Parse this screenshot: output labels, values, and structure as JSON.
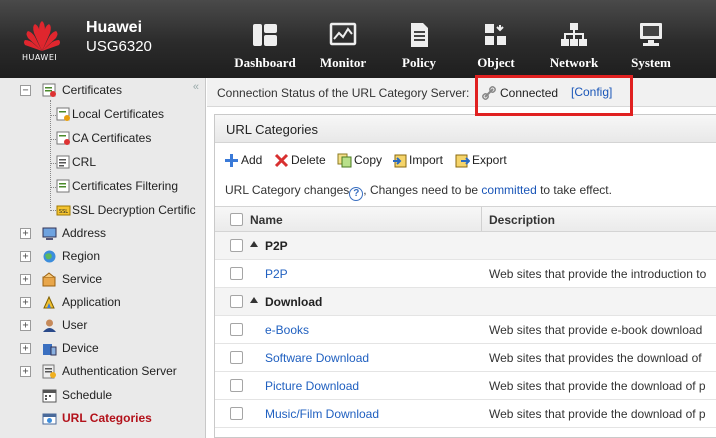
{
  "header": {
    "brand": "HUAWEI",
    "vendor": "Huawei",
    "model": "USG6320",
    "nav": [
      {
        "id": "dashboard",
        "label": "Dashboard"
      },
      {
        "id": "monitor",
        "label": "Monitor"
      },
      {
        "id": "policy",
        "label": "Policy"
      },
      {
        "id": "object",
        "label": "Object",
        "active": true
      },
      {
        "id": "network",
        "label": "Network"
      },
      {
        "id": "system",
        "label": "System"
      }
    ]
  },
  "sidebar": {
    "collapse_icon": "«",
    "items": [
      {
        "label": "Certificates",
        "expander": "−"
      },
      {
        "label": "Local Certificates"
      },
      {
        "label": "CA Certificates"
      },
      {
        "label": "CRL"
      },
      {
        "label": "Certificates Filtering"
      },
      {
        "label": "SSL Decryption Certific"
      },
      {
        "label": "Address",
        "expander": "+"
      },
      {
        "label": "Region",
        "expander": "+"
      },
      {
        "label": "Service",
        "expander": "+"
      },
      {
        "label": "Application",
        "expander": "+"
      },
      {
        "label": "User",
        "expander": "+"
      },
      {
        "label": "Device",
        "expander": "+"
      },
      {
        "label": "Authentication Server",
        "expander": "+"
      },
      {
        "label": "Schedule"
      },
      {
        "label": "URL Categories",
        "selected": true
      }
    ]
  },
  "status": {
    "label": "Connection Status of the URL Category Server:",
    "value": "Connected",
    "config_link": "[Config]"
  },
  "panel": {
    "title": "URL Categories",
    "toolbar": {
      "add": "Add",
      "delete": "Delete",
      "copy": "Copy",
      "import": "Import",
      "export": "Export"
    },
    "notice": {
      "prefix": "URL Category changes",
      "help_icon": "?",
      "middle": ", Changes need to be ",
      "link": "committed",
      "suffix": " to take effect."
    },
    "columns": {
      "name": "Name",
      "description": "Description"
    },
    "rows": [
      {
        "type": "group",
        "name": "P2P"
      },
      {
        "type": "item",
        "name": "P2P",
        "description": "Web sites that provide the introduction to"
      },
      {
        "type": "group",
        "name": "Download"
      },
      {
        "type": "item",
        "name": "e-Books",
        "description": "Web sites that provide e-book download"
      },
      {
        "type": "item",
        "name": "Software Download",
        "description": "Web sites that provides the download of"
      },
      {
        "type": "item",
        "name": "Picture Download",
        "description": "Web sites that provide the download of p"
      },
      {
        "type": "item",
        "name": "Music/Film Download",
        "description": "Web sites that provide the download of p"
      }
    ]
  },
  "colors": {
    "header_bg": "#2b2b2b",
    "brand_red": "#e0262e",
    "link_blue": "#1a56b8",
    "selected_text": "#b3121b",
    "highlight_red": "#e02020"
  }
}
